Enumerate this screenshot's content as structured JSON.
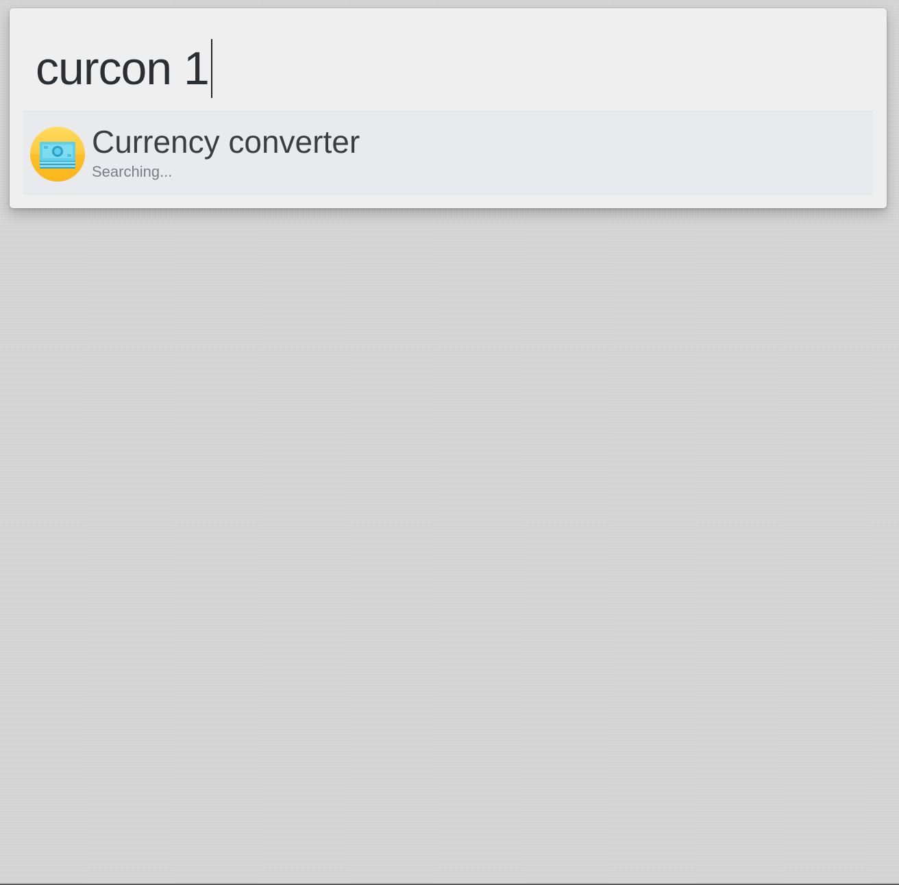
{
  "launcher": {
    "query": "curcon 1",
    "results": [
      {
        "title": "Currency converter",
        "subtitle": "Searching...",
        "icon": "money-banknote-icon"
      }
    ]
  },
  "colors": {
    "panel_background": "#efeff0",
    "selected_row": "#e9eaee",
    "icon_circle": "#fdc42f",
    "banknote": "#4fc3e0",
    "text_primary": "#2b2f31",
    "text_secondary": "#7b7f83"
  }
}
